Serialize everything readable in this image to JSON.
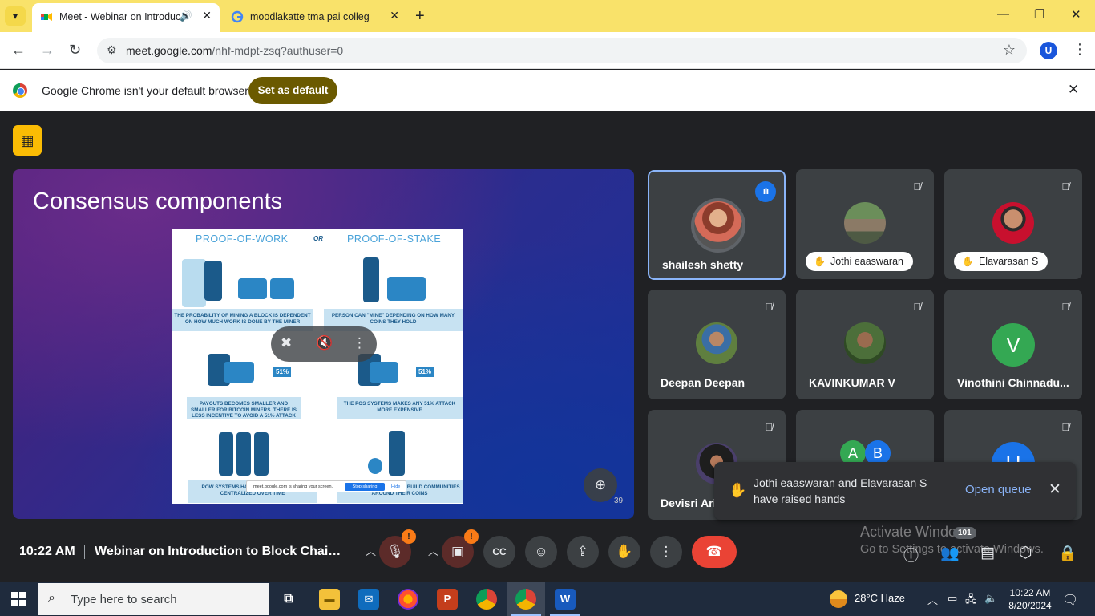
{
  "browser": {
    "tabs": [
      {
        "title": "Meet - Webinar on Introduc",
        "active": true,
        "sound_icon": "speaker-icon"
      },
      {
        "title": "moodlakatte tma pai college - (",
        "active": false
      }
    ],
    "address": {
      "domain": "meet.google.com",
      "path": "/nhf-mdpt-zsq?authuser=0"
    },
    "profile_initial": "U",
    "infobar": {
      "message": "Google Chrome isn't your default browser",
      "button": "Set as default"
    }
  },
  "slide": {
    "title": "Consensus components",
    "left_header": "PROOF-OF-WORK",
    "or": "OR",
    "right_header": "PROOF-OF-STAKE",
    "captions": [
      "THE PROBABILITY OF MINING A BLOCK IS DEPENDENT ON HOW MUCH WORK IS DONE BY THE MINER",
      "PERSON CAN \"MINE\" DEPENDING ON HOW MANY COINS THEY HOLD",
      "PAYOUTS BECOMES SMALLER AND SMALLER FOR BITCOIN MINERS. THERE IS LESS INCENTIVE TO AVOID A 51% ATTACK",
      "THE POS SYSTEMS MAKES ANY 51% ATTACK MORE EXPENSIVE",
      "POW SYSTEMS HAVE COMMUNITIES - BU CENTRALIZED OVER TIME",
      "DECENTRALIZED - ARD TO BUILD COMMUNITIES AROUND THEIR COINS"
    ],
    "pct_left": "51%",
    "pct_right": "51%",
    "share_text": "meet.google.com is sharing your screen.",
    "stop_sharing": "Stop sharing",
    "hide": "Hide",
    "page_number": "39"
  },
  "participants": [
    {
      "name": "shailesh shetty",
      "speaking": true
    },
    {
      "name": "Jothi eaaswaran",
      "hand_raised": true,
      "muted": true
    },
    {
      "name": "Elavarasan S",
      "hand_raised": true,
      "muted": true
    },
    {
      "name": "Deepan Deepan",
      "muted": true
    },
    {
      "name": "KAVINKUMAR V",
      "muted": true
    },
    {
      "name": "Vinothini Chinnadu...",
      "muted": true,
      "initial": "V",
      "color": "#34a853"
    },
    {
      "name": "Devisri Ari",
      "muted": true
    },
    {
      "initials": [
        "A",
        "B"
      ],
      "colors": [
        "#34a853",
        "#1a73e8"
      ]
    },
    {
      "initial": "U",
      "color": "#1a73e8",
      "muted": true
    }
  ],
  "toast": {
    "message": "Jothi eaaswaran and Elavarasan S have raised hands",
    "action": "Open queue"
  },
  "bottom": {
    "time": "10:22 AM",
    "meeting_title": "Webinar on Introduction to Block Chain ...",
    "people_count": "101",
    "warning_mark": "!"
  },
  "watermark": {
    "line1": "Activate Windows",
    "line2": "Go to Settings to activate Windows."
  },
  "taskbar": {
    "search_placeholder": "Type here to search",
    "weather": "28°C  Haze",
    "time": "10:22 AM",
    "date": "8/20/2024"
  },
  "colors": {
    "accent": "#1a73e8",
    "end_call": "#ea4335",
    "tabstrip": "#f9e26a",
    "setdefault": "#6b5a00",
    "warning": "#fa7b17"
  }
}
